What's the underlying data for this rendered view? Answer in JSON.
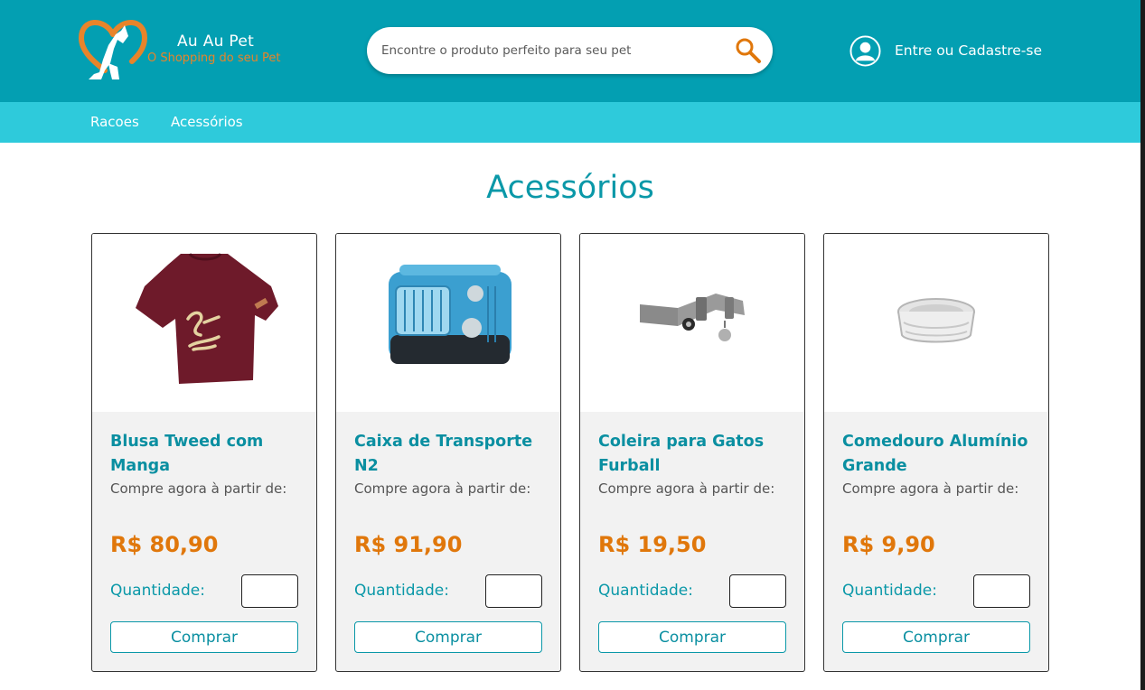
{
  "header": {
    "brand_name": "Au Au Pet",
    "brand_tagline": "O Shopping do seu Pet",
    "search_placeholder": "Encontre o produto perfeito para seu pet",
    "account_label": "Entre ou Cadastre-se"
  },
  "nav": {
    "items": [
      "Racoes",
      "Acessórios"
    ]
  },
  "page": {
    "title": "Acessórios"
  },
  "products": [
    {
      "name": "Blusa Tweed com Manga",
      "from_label": "Compre agora à partir de:",
      "price": "R$ 80,90",
      "qty_label": "Quantidade:",
      "buy_label": "Comprar",
      "image_icon": "shirt-image"
    },
    {
      "name": "Caixa de Transporte N2",
      "from_label": "Compre agora à partir de:",
      "price": "R$ 91,90",
      "qty_label": "Quantidade:",
      "buy_label": "Comprar",
      "image_icon": "pet-carrier-image"
    },
    {
      "name": "Coleira para Gatos Furball",
      "from_label": "Compre agora à partir de:",
      "price": "R$ 19,50",
      "qty_label": "Quantidade:",
      "buy_label": "Comprar",
      "image_icon": "cat-collar-image"
    },
    {
      "name": "Comedouro Alumínio Grande",
      "from_label": "Compre agora à partir de:",
      "price": "R$ 9,90",
      "qty_label": "Quantidade:",
      "buy_label": "Comprar",
      "image_icon": "feeding-bowl-image"
    }
  ],
  "colors": {
    "header_bg": "#039fb2",
    "nav_bg": "#2ecadb",
    "accent_teal": "#0a98a8",
    "price_orange": "#e0770b"
  }
}
